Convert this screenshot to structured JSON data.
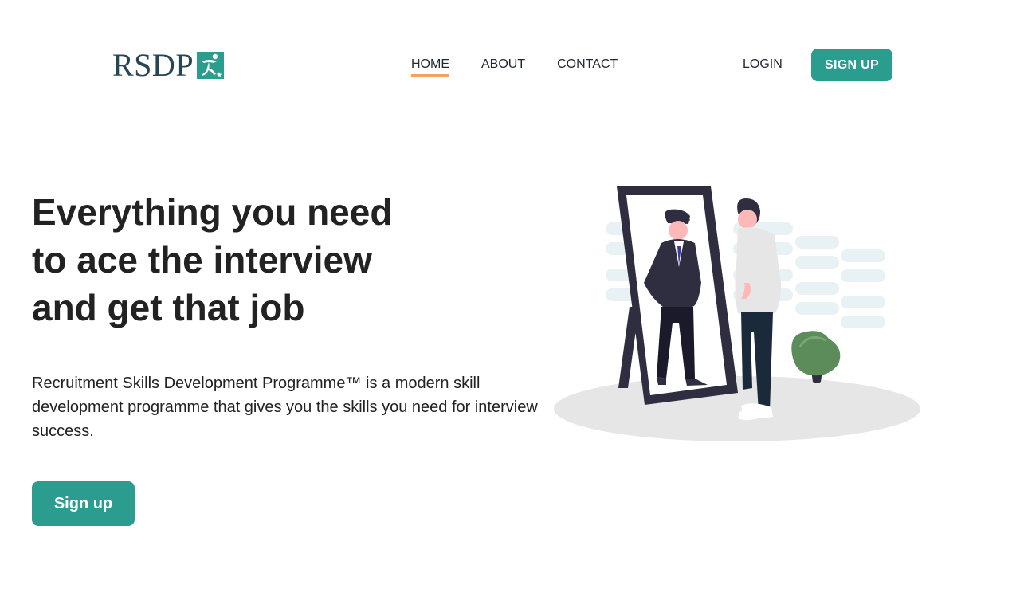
{
  "header": {
    "logo_text": "RSDP",
    "nav": [
      {
        "label": "HOME",
        "active": true
      },
      {
        "label": "ABOUT",
        "active": false
      },
      {
        "label": "CONTACT",
        "active": false
      }
    ],
    "login_label": "LOGIN",
    "signup_label": "SIGN UP"
  },
  "hero": {
    "headline_lines": [
      "Everything you need",
      "to ace the interview",
      "and get that job"
    ],
    "description": "Recruitment Skills Development Programme™ is a modern skill development programme that gives you the skills you need for interview success.",
    "cta_label": "Sign up"
  },
  "colors": {
    "brand_teal": "#2a9d8f",
    "logo_navy": "#264653",
    "active_underline": "#f4a261"
  },
  "icons": {
    "logo_mark": "runner-flag-icon",
    "hero_art": "man-looking-in-mirror-illustration"
  }
}
